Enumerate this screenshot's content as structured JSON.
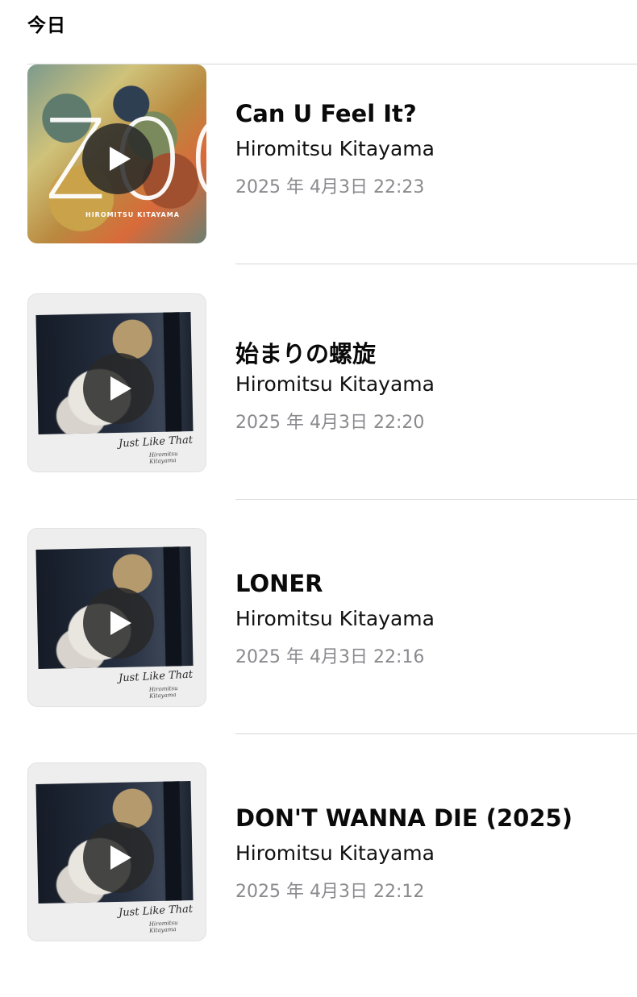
{
  "header": {
    "title": "今日"
  },
  "items": [
    {
      "title": "Can U Feel It?",
      "artist": "Hiromitsu Kitayama",
      "timestamp": "2025 年 4月3日 22:23",
      "art_text": "ZOO",
      "art_subtext": "HIROMITSU KITAYAMA"
    },
    {
      "title": "始まりの螺旋",
      "artist": "Hiromitsu Kitayama",
      "timestamp": "2025 年 4月3日 22:20",
      "art_text": "Just Like That",
      "art_subtext": "Hiromitsu Kitayama"
    },
    {
      "title": "LONER",
      "artist": "Hiromitsu Kitayama",
      "timestamp": "2025 年 4月3日 22:16",
      "art_text": "Just Like That",
      "art_subtext": "Hiromitsu Kitayama"
    },
    {
      "title": "DON'T WANNA DIE (2025)",
      "artist": "Hiromitsu Kitayama",
      "timestamp": "2025 年 4月3日 22:12",
      "art_text": "Just Like That",
      "art_subtext": "Hiromitsu Kitayama"
    }
  ],
  "colors": {
    "secondary_text": "#8a8a8e",
    "divider": "#d6d6d6",
    "play_overlay": "#282828"
  }
}
